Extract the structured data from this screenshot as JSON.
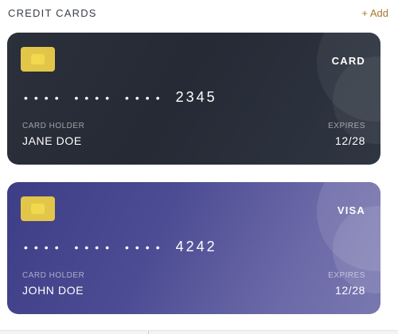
{
  "header": {
    "title": "CREDIT CARDS",
    "add_label": "+ Add"
  },
  "cards": [
    {
      "brand": "CARD",
      "masked": "•••• •••• ••••",
      "last4": "2345",
      "holder_label": "CARD HOLDER",
      "holder_name": "JANE DOE",
      "expires_label": "EXPIRES",
      "expires": "12/28",
      "background": "#2b303b"
    },
    {
      "brand": "VISA",
      "masked": "•••• •••• ••••",
      "last4": "4242",
      "holder_label": "CARD HOLDER",
      "holder_name": "JOHN DOE",
      "expires_label": "EXPIRES",
      "expires": "12/28",
      "background": "#4c4c94"
    }
  ],
  "colors": {
    "accent": "#a8792a",
    "chip": "#e2c64a"
  }
}
